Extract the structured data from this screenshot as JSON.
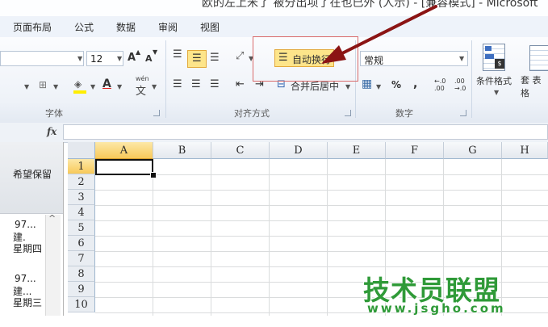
{
  "window": {
    "title_partial": "欧的左上米了 被分出项了在也已外 (人示) - [兼容模式] - Microsoft"
  },
  "tabs": [
    "页面布局",
    "公式",
    "数据",
    "审阅",
    "视图"
  ],
  "font_group": {
    "label": "字体",
    "font_size": "12",
    "grow_font": "A",
    "shrink_font": "A",
    "font_color_letter": "A",
    "phonetic_glyph": "wén"
  },
  "alignment_group": {
    "label": "对齐方式",
    "wrap_text_label": "自动换行",
    "merge_center_label": "合并后居中"
  },
  "number_group": {
    "label": "数字",
    "format_value": "常规",
    "percent": "%",
    "comma": ",",
    "increase_decimal": "←.0 .00",
    "decrease_decimal": ".00 →.0"
  },
  "styles_group": {
    "conditional_format": "条件格式",
    "table_format_partial": "套 表格"
  },
  "formula_bar": {
    "fx": "fx",
    "value": ""
  },
  "left_pane": {
    "header_text": "希望保留",
    "items": [
      {
        "line1": "97...",
        "line2": "建.",
        "line3": "星期四"
      },
      {
        "line1": "97...",
        "line2": "建...",
        "line3": "星期三"
      }
    ]
  },
  "sheet": {
    "columns": [
      "A",
      "B",
      "C",
      "D",
      "E",
      "F",
      "G",
      "H"
    ],
    "rows": [
      "1",
      "2",
      "3",
      "4",
      "5",
      "6",
      "7",
      "8",
      "9",
      "10"
    ],
    "active_cell": "A1"
  },
  "watermark": {
    "text": "技术员联盟",
    "url": "www.jsgho.com"
  }
}
